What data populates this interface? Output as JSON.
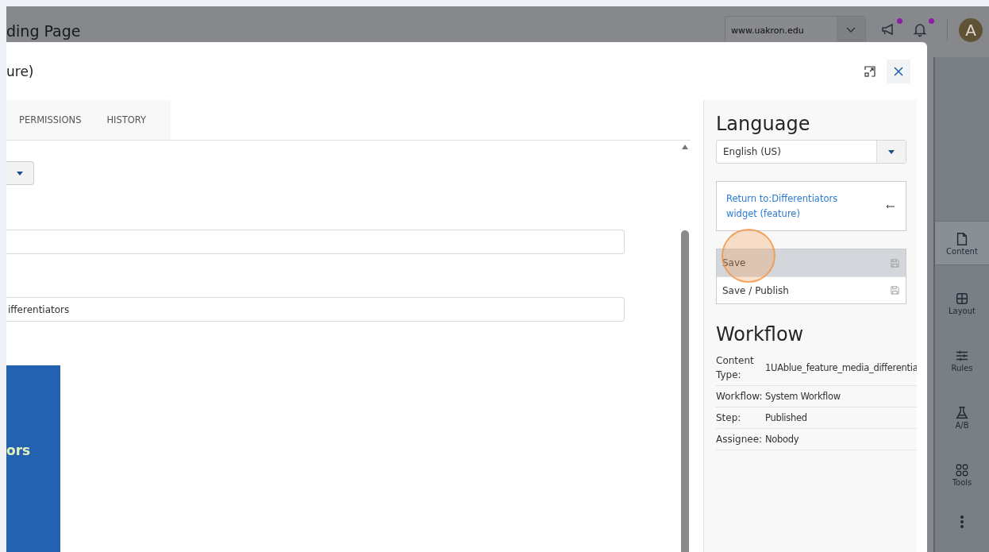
{
  "app_header": {
    "page_title": "ding Page",
    "site_select": {
      "value": "www.uakron.edu"
    },
    "notifications": [
      {
        "kind": "announcements",
        "unread": true
      },
      {
        "kind": "alerts",
        "unread": true
      }
    ],
    "avatar": {
      "initial": "A"
    }
  },
  "side_rail": {
    "items": [
      {
        "label": "Content",
        "selected": true
      },
      {
        "label": "Layout",
        "selected": false
      },
      {
        "label": "Rules",
        "selected": false
      },
      {
        "label": "A/B",
        "selected": false
      },
      {
        "label": "Tools",
        "selected": false
      }
    ]
  },
  "modal": {
    "title": "ure)",
    "tabs": [
      {
        "label": "PERMISSIONS",
        "selected": false
      },
      {
        "label": "HISTORY",
        "selected": false
      }
    ],
    "fields": [
      {
        "kind": "empty"
      },
      {
        "kind": "filled",
        "value": "ifferentiators"
      }
    ],
    "preview": {
      "text": "ors"
    },
    "language": {
      "heading": "Language",
      "value": "English (US)"
    },
    "return_link": "Return to:Differentiators widget (feature)",
    "actions": [
      {
        "label": "Save",
        "selected": true
      },
      {
        "label": "Save / Publish",
        "selected": false
      }
    ],
    "workflow": {
      "heading": "Workflow",
      "rows": [
        {
          "label": "Content Type:",
          "value": "1UAblue_feature_media_differentia"
        },
        {
          "label": "Workflow:",
          "value": "System Workflow"
        },
        {
          "label": "Step:",
          "value": "Published"
        },
        {
          "label": "Assignee:",
          "value": "Nobody"
        }
      ]
    }
  }
}
